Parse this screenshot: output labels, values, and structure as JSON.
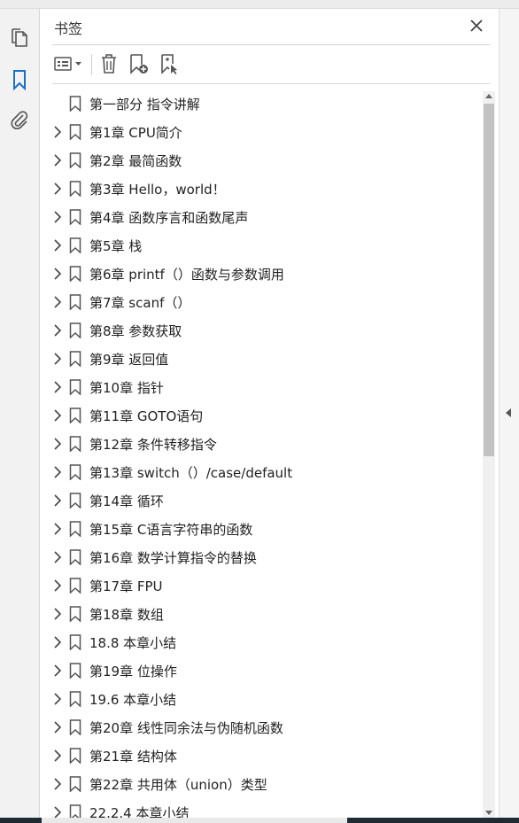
{
  "panel": {
    "title": "书签",
    "close_icon": "close-icon"
  },
  "leftbar": {
    "icons": [
      "pages-icon",
      "bookmark-icon",
      "attachment-icon"
    ]
  },
  "toolbar": {
    "icons": [
      "options-menu-icon",
      "delete-icon",
      "new-bookmark-icon",
      "bookmark-from-structure-icon"
    ]
  },
  "bookmarks": [
    {
      "label": "第一部分  指令讲解",
      "expandable": false
    },
    {
      "label": "第1章  CPU简介",
      "expandable": true
    },
    {
      "label": "第2章  最简函数",
      "expandable": true
    },
    {
      "label": "第3章  Hello，world！",
      "expandable": true
    },
    {
      "label": "第4章  函数序言和函数尾声",
      "expandable": true
    },
    {
      "label": "第5章  栈",
      "expandable": true
    },
    {
      "label": "第6章  printf（）函数与参数调用",
      "expandable": true
    },
    {
      "label": "第7章  scanf（）",
      "expandable": true
    },
    {
      "label": "第8章  参数获取",
      "expandable": true
    },
    {
      "label": "第9章  返回值",
      "expandable": true
    },
    {
      "label": "第10章  指针",
      "expandable": true
    },
    {
      "label": "第11章  GOTO语句",
      "expandable": true
    },
    {
      "label": "第12章  条件转移指令",
      "expandable": true
    },
    {
      "label": "第13章  switch（）/case/default",
      "expandable": true
    },
    {
      "label": "第14章  循环",
      "expandable": true
    },
    {
      "label": "第15章  C语言字符串的函数",
      "expandable": true
    },
    {
      "label": "第16章  数学计算指令的替换",
      "expandable": true
    },
    {
      "label": "第17章  FPU",
      "expandable": true
    },
    {
      "label": "第18章  数组",
      "expandable": true
    },
    {
      "label": "18.8  本章小结",
      "expandable": true
    },
    {
      "label": "第19章  位操作",
      "expandable": true
    },
    {
      "label": "19.6  本章小结",
      "expandable": true
    },
    {
      "label": "第20章  线性同余法与伪随机函数",
      "expandable": true
    },
    {
      "label": "第21章  结构体",
      "expandable": true
    },
    {
      "label": "第22章  共用体（union）类型",
      "expandable": true
    },
    {
      "label": "22.2.4  本章小结",
      "expandable": true
    }
  ],
  "colors": {
    "accent": "#1a6fc9",
    "icon": "#555555"
  }
}
